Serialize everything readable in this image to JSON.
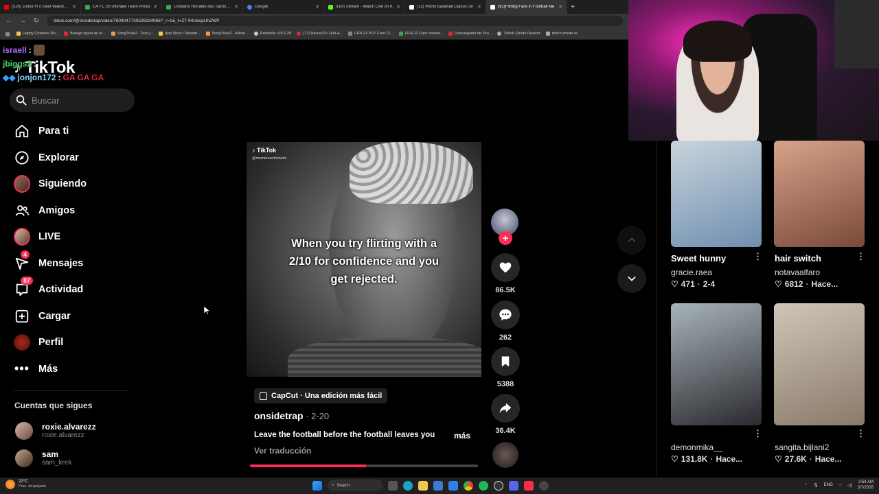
{
  "browser": {
    "tabs": [
      {
        "title": "(526) Junior H x Gael Valenzuela",
        "color": "#ff0000"
      },
      {
        "title": "EA FC 26 Ultimate Team Prices",
        "color": "#3aa655"
      },
      {
        "title": "Cristiano Ronaldo dos Santos A",
        "color": "#3aa655"
      },
      {
        "title": "Google",
        "color": "#4285f4"
      },
      {
        "title": "nJon Stream - Watch Live on K",
        "color": "#53fc18"
      },
      {
        "title": "(12) World Baseball Classic on",
        "color": "#ffffff"
      },
      {
        "title": "(91)Flirting Fails in Football Me",
        "color": "#ffffff"
      }
    ],
    "url": "tiktok.com/@onsidetrap/video/7609047730526194966?_r=1&_t=ZT-94U6opUhZWP",
    "bookmarks": [
      "Happy Cristiano Ro...",
      "Burago figura de to...",
      "SongTrivia2 - Test y...",
      "App Store / Stream...",
      "SongTrivia2 - Adivin...",
      "Peletools v26.0.28",
      "(77) Racco97s Zest-A...",
      "FIFA 23 PUT Card Cr...",
      "FIFA 23 Card creator...",
      "Descargador de You...",
      "Twitch Emote Resizer",
      "twitch emote re"
    ]
  },
  "overlay_chat": {
    "line1_user": "israell",
    "line2_user": "jbiggs2",
    "line3_user": "jonjon172",
    "line3_msg": "GA GA GA"
  },
  "tiktok": {
    "logo": "TikTok",
    "search_placeholder": "Buscar",
    "nav": [
      {
        "label": "Para ti",
        "icon": "home-icon"
      },
      {
        "label": "Explorar",
        "icon": "compass-icon"
      },
      {
        "label": "Siguiendo",
        "icon": "following-avatar"
      },
      {
        "label": "Amigos",
        "icon": "friends-icon"
      },
      {
        "label": "LIVE",
        "icon": "live-avatar"
      },
      {
        "label": "Mensajes",
        "icon": "messages-icon",
        "badge": "4"
      },
      {
        "label": "Actividad",
        "icon": "activity-icon",
        "badge": "87"
      },
      {
        "label": "Cargar",
        "icon": "upload-icon"
      },
      {
        "label": "Perfil",
        "icon": "profile-avatar"
      },
      {
        "label": "Más",
        "icon": "more-icon"
      }
    ],
    "following_title": "Cuentas que sigues",
    "following": [
      {
        "name": "roxie.alvarezz",
        "handle": "roxie.alvarezz"
      },
      {
        "name": "sam",
        "handle": "sam_krek"
      }
    ]
  },
  "video": {
    "overlay_logo": "TikTok",
    "overlay_handle": "@memereactionvids",
    "caption": "When you try flirting with a 2/10 for confidence and you get rejected.",
    "capcut_label": "CapCut · Una edición más fácil",
    "author": "onsidetrap",
    "date": " · 2-20",
    "description": "Leave the football before the football leaves you",
    "more_label": "más",
    "translate_label": "Ver traducción",
    "progress": 0.51,
    "likes": "86.5K",
    "comments": "262",
    "saves": "5388",
    "shares": "36.4K"
  },
  "feed": [
    {
      "title": "Sweet hunny",
      "user": "gracie.raea",
      "likes": "471",
      "meta": "2-4",
      "colors": [
        "#c9d4dc",
        "#6f8fb0"
      ]
    },
    {
      "title": "hair switch",
      "user": "notavaalfaro",
      "likes": "6812",
      "meta": "Hace...",
      "colors": [
        "#d6a38a",
        "#7a4a3a"
      ]
    },
    {
      "title": "",
      "user": "demonmika__",
      "likes": "131.8K",
      "meta": "Hace...",
      "colors": [
        "#a8b4b8",
        "#2a2a30"
      ]
    },
    {
      "title": "",
      "user": "sangita.bijlani2",
      "likes": "27.6K",
      "meta": "Hace...",
      "colors": [
        "#cfc6b8",
        "#8a7a6a"
      ]
    }
  ],
  "taskbar": {
    "temperature": "22°C",
    "weather": "Prac. despejado",
    "search_label": "Search",
    "lang": "ENG",
    "time": "3:54 AM",
    "date": "3/7/2026"
  }
}
